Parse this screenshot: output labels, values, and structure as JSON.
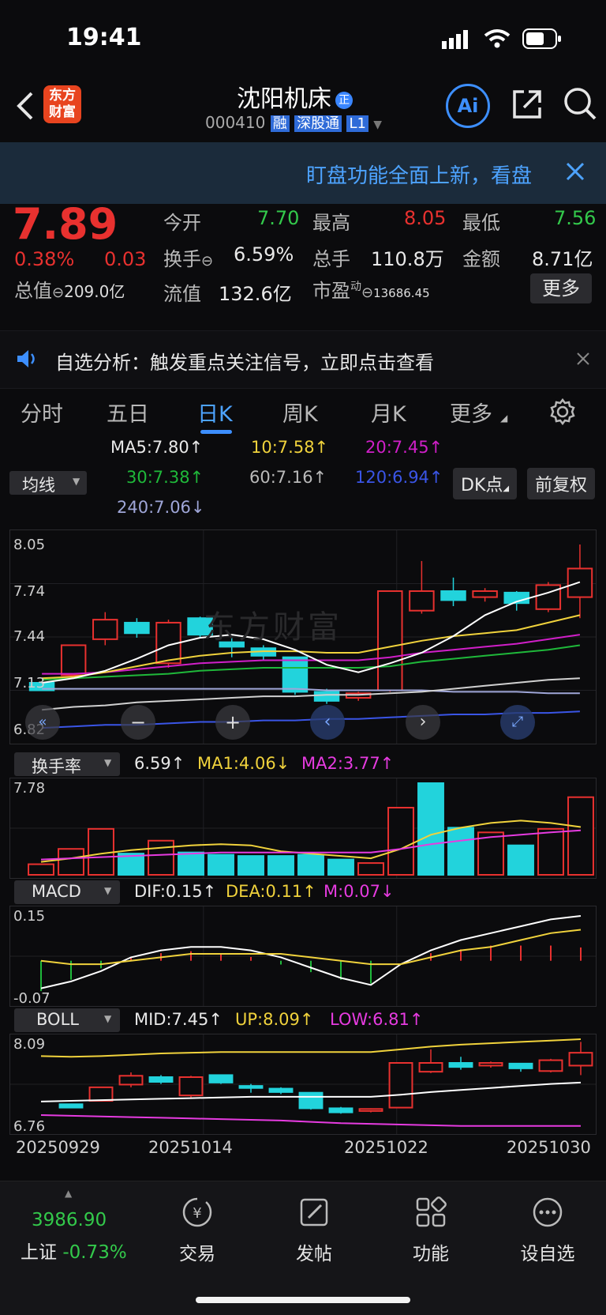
{
  "status": {
    "time": "19:41"
  },
  "header": {
    "logo_line1": "东方",
    "logo_line2": "财富",
    "title": "沈阳机床",
    "title_badge": "正",
    "code": "000410",
    "tags": [
      "融",
      "深股通",
      "L1"
    ],
    "ai_label": "Ai"
  },
  "banner": {
    "text": "盯盘功能全面上新，看盘"
  },
  "quote": {
    "price": "7.89",
    "change_pct": "0.38%",
    "change": "0.03",
    "total_value_label": "总值",
    "total_value": "209.0亿",
    "open_label": "今开",
    "open": "7.70",
    "high_label": "最高",
    "high": "8.05",
    "low_label": "最低",
    "low": "7.56",
    "turnover_label": "换手",
    "turnover": "6.59%",
    "volume_label": "总手",
    "volume": "110.8万",
    "amount_label": "金额",
    "amount": "8.71亿",
    "float_label": "流值",
    "float_value": "132.6亿",
    "pe_label": "市盈",
    "pe_sup": "动",
    "pe": "13686.45",
    "more_label": "更多"
  },
  "notice": {
    "text": "自选分析：触发重点关注信号，立即点击查看"
  },
  "tabs": {
    "items": [
      "分时",
      "五日",
      "日K",
      "周K",
      "月K",
      "更多"
    ],
    "active": "日K"
  },
  "ma": {
    "select_label": "均线",
    "ma5": "MA5:7.80↑",
    "ma10": "10:7.58↑",
    "ma20": "20:7.45↑",
    "ma30": "30:7.38↑",
    "ma60": "60:7.16↑",
    "ma120": "120:6.94↑",
    "ma240": "240:7.06↓",
    "dk_label": "DK点",
    "fq_label": "前复权"
  },
  "colors": {
    "up": "#e8312f",
    "down": "#22d3dc",
    "ma5": "#ffffff",
    "ma10": "#f0d23c",
    "ma20": "#d01fc8",
    "ma30": "#1fb83a",
    "ma60": "#d0d0d0",
    "ma120": "#3a55e6",
    "ma240": "#9fa6d8"
  },
  "chart_data": [
    {
      "type": "candlestick",
      "title": "",
      "y_ticks": [
        "8.05",
        "7.74",
        "7.44",
        "7.13",
        "6.82"
      ],
      "ylim": [
        6.82,
        8.05
      ],
      "candles": [
        {
          "open": 7.13,
          "close": 7.08,
          "high": 7.13,
          "low": 7.08
        },
        {
          "open": 7.18,
          "close": 7.38,
          "high": 7.38,
          "low": 7.18
        },
        {
          "open": 7.42,
          "close": 7.55,
          "high": 7.6,
          "low": 7.38
        },
        {
          "open": 7.53,
          "close": 7.46,
          "high": 7.56,
          "low": 7.43
        },
        {
          "open": 7.26,
          "close": 7.53,
          "high": 7.55,
          "low": 7.23
        },
        {
          "open": 7.56,
          "close": 7.45,
          "high": 7.57,
          "low": 7.43
        },
        {
          "open": 7.4,
          "close": 7.37,
          "high": 7.43,
          "low": 7.3
        },
        {
          "open": 7.36,
          "close": 7.31,
          "high": 7.38,
          "low": 7.28
        },
        {
          "open": 7.3,
          "close": 7.07,
          "high": 7.3,
          "low": 7.05
        },
        {
          "open": 7.07,
          "close": 7.01,
          "high": 7.09,
          "low": 6.99
        },
        {
          "open": 7.03,
          "close": 7.06,
          "high": 7.07,
          "low": 7.01
        },
        {
          "open": 7.08,
          "close": 7.74,
          "high": 7.74,
          "low": 7.07
        },
        {
          "open": 7.61,
          "close": 7.74,
          "high": 7.94,
          "low": 7.59
        },
        {
          "open": 7.74,
          "close": 7.68,
          "high": 7.83,
          "low": 7.64
        },
        {
          "open": 7.7,
          "close": 7.74,
          "high": 7.76,
          "low": 7.67
        },
        {
          "open": 7.73,
          "close": 7.66,
          "high": 7.74,
          "low": 7.61
        },
        {
          "open": 7.62,
          "close": 7.78,
          "high": 7.8,
          "low": 7.6
        },
        {
          "open": 7.7,
          "close": 7.89,
          "high": 8.05,
          "low": 7.56
        }
      ],
      "ma5": [
        7.13,
        7.16,
        7.21,
        7.29,
        7.38,
        7.43,
        7.45,
        7.42,
        7.35,
        7.25,
        7.2,
        7.26,
        7.33,
        7.44,
        7.58,
        7.67,
        7.73,
        7.8
      ],
      "ma10": [
        7.16,
        7.17,
        7.2,
        7.24,
        7.28,
        7.31,
        7.33,
        7.34,
        7.34,
        7.33,
        7.33,
        7.37,
        7.41,
        7.44,
        7.46,
        7.48,
        7.53,
        7.58
      ],
      "ma20": [
        7.19,
        7.19,
        7.2,
        7.22,
        7.24,
        7.26,
        7.27,
        7.28,
        7.28,
        7.28,
        7.28,
        7.3,
        7.33,
        7.35,
        7.37,
        7.39,
        7.42,
        7.45
      ],
      "ma30": [
        7.15,
        7.16,
        7.17,
        7.18,
        7.19,
        7.21,
        7.22,
        7.23,
        7.23,
        7.23,
        7.23,
        7.24,
        7.27,
        7.29,
        7.31,
        7.33,
        7.35,
        7.38
      ],
      "ma60": [
        6.95,
        6.97,
        6.98,
        7.0,
        7.01,
        7.02,
        7.03,
        7.04,
        7.04,
        7.05,
        7.05,
        7.06,
        7.07,
        7.09,
        7.11,
        7.13,
        7.15,
        7.16
      ],
      "ma120": [
        6.83,
        6.84,
        6.85,
        6.85,
        6.86,
        6.87,
        6.87,
        6.88,
        6.88,
        6.89,
        6.89,
        6.9,
        6.91,
        6.92,
        6.92,
        6.93,
        6.93,
        6.94
      ],
      "ma240": [
        7.09,
        7.09,
        7.09,
        7.09,
        7.09,
        7.09,
        7.09,
        7.09,
        7.09,
        7.08,
        7.08,
        7.08,
        7.08,
        7.07,
        7.07,
        7.07,
        7.06,
        7.06
      ]
    },
    {
      "type": "bar",
      "title": "换手率",
      "value_label": "6.59↑",
      "ma1_label": "MA1:4.06↓",
      "ma2_label": "MA2:3.77↑",
      "y_ticks": [
        "7.78"
      ],
      "ylim": [
        0,
        7.78
      ],
      "values": [
        0.9,
        2.2,
        3.9,
        1.8,
        2.9,
        1.9,
        1.7,
        1.6,
        1.6,
        1.7,
        1.3,
        1.0,
        5.7,
        7.78,
        4.0,
        3.6,
        2.5,
        3.9,
        6.59
      ],
      "up": [
        true,
        true,
        true,
        false,
        true,
        false,
        false,
        false,
        false,
        false,
        false,
        true,
        true,
        false,
        false,
        true,
        false,
        true,
        true
      ],
      "ma1": [
        1.1,
        1.4,
        1.8,
        2.1,
        2.3,
        2.5,
        2.6,
        2.5,
        2.0,
        1.8,
        1.6,
        1.4,
        2.2,
        3.4,
        4.0,
        4.4,
        4.6,
        4.4,
        4.06
      ],
      "ma2": [
        1.3,
        1.4,
        1.5,
        1.6,
        1.7,
        1.8,
        1.9,
        1.9,
        1.9,
        1.9,
        1.9,
        1.9,
        2.2,
        2.6,
        2.9,
        3.2,
        3.4,
        3.6,
        3.77
      ]
    },
    {
      "type": "line",
      "title": "MACD",
      "dif_label": "DIF:0.15↑",
      "dea_label": "DEA:0.11↑",
      "m_label": "M:0.07↓",
      "y_ticks": [
        "0.15",
        "-0.07"
      ],
      "ylim": [
        -0.07,
        0.15
      ],
      "dif": [
        -0.06,
        -0.04,
        -0.01,
        0.03,
        0.05,
        0.06,
        0.06,
        0.05,
        0.03,
        0.0,
        -0.03,
        -0.05,
        0.01,
        0.05,
        0.08,
        0.1,
        0.12,
        0.14,
        0.15
      ],
      "dea": [
        0.02,
        0.01,
        0.01,
        0.02,
        0.03,
        0.04,
        0.04,
        0.04,
        0.04,
        0.03,
        0.02,
        0.01,
        0.01,
        0.03,
        0.05,
        0.06,
        0.08,
        0.1,
        0.11
      ],
      "macd": [
        -0.16,
        -0.1,
        -0.04,
        0.02,
        0.04,
        0.05,
        0.04,
        0.02,
        -0.02,
        -0.06,
        -0.1,
        -0.12,
        0.0,
        0.04,
        0.06,
        0.08,
        0.08,
        0.08,
        0.07
      ]
    },
    {
      "type": "candlestick",
      "title": "BOLL",
      "mid_label": "MID:7.45↑",
      "up_label": "UP:8.09↑",
      "low_label": "LOW:6.81↑",
      "y_ticks": [
        "8.09",
        "6.76"
      ],
      "ylim": [
        6.76,
        8.09
      ],
      "up": [
        7.84,
        7.83,
        7.84,
        7.86,
        7.88,
        7.89,
        7.9,
        7.9,
        7.9,
        7.9,
        7.9,
        7.9,
        7.94,
        7.98,
        8.01,
        8.03,
        8.05,
        8.07,
        8.09
      ],
      "mid": [
        7.17,
        7.18,
        7.19,
        7.2,
        7.21,
        7.22,
        7.23,
        7.24,
        7.24,
        7.24,
        7.24,
        7.24,
        7.27,
        7.31,
        7.34,
        7.37,
        7.4,
        7.43,
        7.45
      ],
      "low": [
        6.97,
        6.96,
        6.95,
        6.94,
        6.93,
        6.92,
        6.91,
        6.9,
        6.89,
        6.87,
        6.85,
        6.84,
        6.83,
        6.82,
        6.81,
        6.81,
        6.81,
        6.81,
        6.81
      ],
      "x_labels": [
        "20250929",
        "20251014",
        "20251022",
        "20251030"
      ]
    }
  ],
  "bottom": {
    "index_value": "3986.90",
    "index_name": "上证",
    "index_change": "-0.73%",
    "nav": [
      "交易",
      "发帖",
      "功能",
      "设自选"
    ]
  }
}
